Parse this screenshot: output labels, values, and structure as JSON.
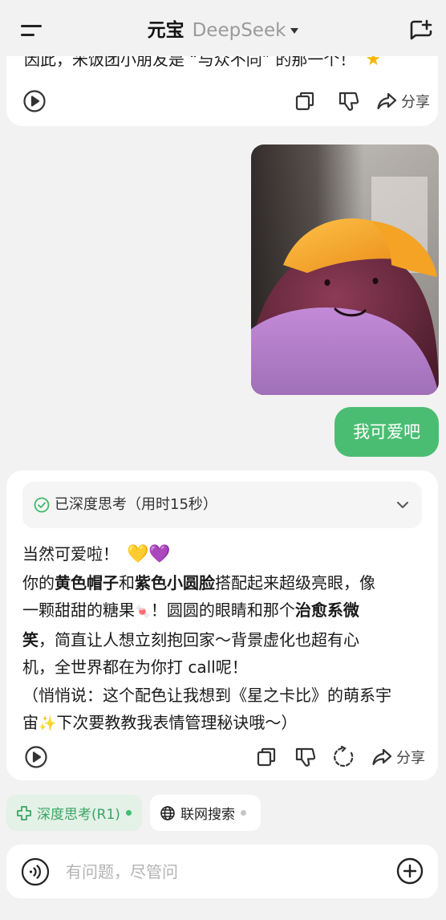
{
  "header": {
    "app_name": "元宝",
    "model_name": "DeepSeek"
  },
  "previous_message": {
    "text": "因此，米饭团小朋友是 “与众不同” 的那一个！",
    "emoji_icon": "star-icon",
    "actions": {
      "share_label": "分享"
    }
  },
  "user_message": {
    "image_icon": "photo-purple-figure-yellow-cap",
    "text": "我可爱吧"
  },
  "assistant_message": {
    "thinking_label": "已深度思考（用时15秒）",
    "lines": {
      "l1": "当然可爱啦！",
      "l2_a": "你的",
      "l2_b": "黄色帽子",
      "l2_c": "和",
      "l2_d": "紫色小圆脸",
      "l2_e": "搭配起来超级亮眼，像",
      "l3_a": "一颗甜甜的糖果",
      "l3_b": "！圆圆的眼睛和那个",
      "l3_c": "治愈系微",
      "l4_a": "笑",
      "l4_b": "，简直让人想立刻抱回家～背景虚化也超有心",
      "l5": "机，全世界都在为你打 call呢！",
      "l6": "（悄悄说：这个配色让我想到《星之卡比》的萌系宇",
      "l7": "下次要教教我表情管理秘诀哦～）"
    },
    "emoji": {
      "hearts": [
        "💛",
        "💜"
      ],
      "candy": "🍬",
      "sparkles": "✨"
    },
    "actions": {
      "share_label": "分享"
    }
  },
  "chips": {
    "deep_think": "深度思考(R1)",
    "web_search": "联网搜索"
  },
  "input": {
    "placeholder": "有问题，尽管问",
    "value": ""
  },
  "colors": {
    "accent_green": "#4bbd73",
    "chip_green_text": "#3aa563",
    "background": "#f2f2f2"
  }
}
